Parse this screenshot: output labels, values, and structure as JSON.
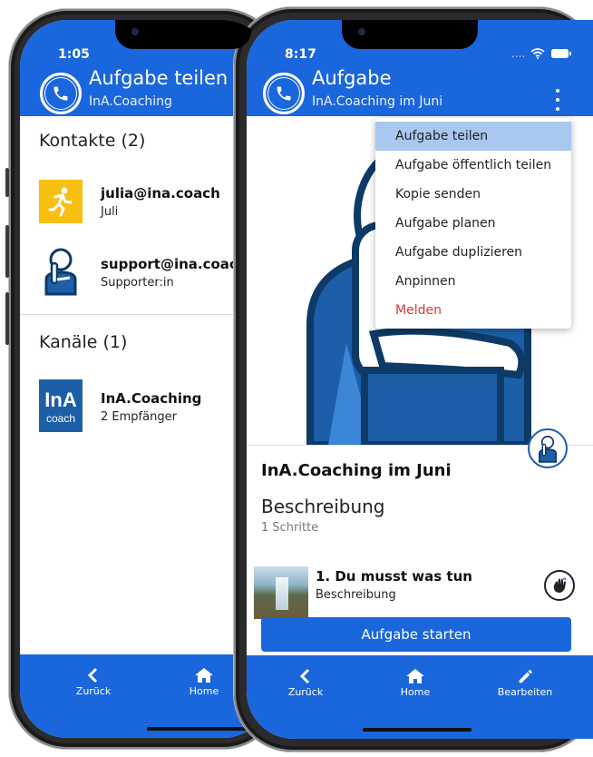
{
  "left_phone": {
    "status_time": "1:05",
    "header_title": "Aufgabe teilen",
    "header_subtitle": "InA.Coaching",
    "contacts_title": "Kontakte (2)",
    "contacts": [
      {
        "name": "julia@ina.coach",
        "sub": "Juli"
      },
      {
        "name": "support@ina.coach",
        "sub": "Supporter:in"
      }
    ],
    "channels_title": "Kanäle (1)",
    "channels": [
      {
        "name": "InA.Coaching",
        "sub": "2 Empfänger",
        "logo_top": "InA",
        "logo_bottom": "coach"
      }
    ],
    "nav": {
      "back": "Zurück",
      "home": "Home"
    }
  },
  "right_phone": {
    "status_time": "8:17",
    "status_signal": "....",
    "header_title": "Aufgabe",
    "header_subtitle": "InA.Coaching im Juni",
    "menu": [
      "Aufgabe teilen",
      "Aufgabe öffentlich teilen",
      "Kopie senden",
      "Aufgabe planen",
      "Aufgabe duplizieren",
      "Anpinnen",
      "Melden"
    ],
    "task_title": "InA.Coaching im Juni",
    "description_title": "Beschreibung",
    "steps_count": "1 Schritte",
    "step": {
      "title": "1. Du musst was tun",
      "sub": "Beschreibung"
    },
    "start_button": "Aufgabe starten",
    "nav": {
      "back": "Zurück",
      "home": "Home",
      "edit": "Bearbeiten"
    }
  },
  "colors": {
    "primary": "#1a66dc",
    "menu_active": "#a9c8f0",
    "danger": "#d9363e"
  },
  "icons": [
    "phone-icon",
    "chevron-left-icon",
    "home-icon",
    "pencil-icon",
    "kebab-menu-icon",
    "wave-hand-icon",
    "wifi-icon",
    "battery-icon"
  ]
}
